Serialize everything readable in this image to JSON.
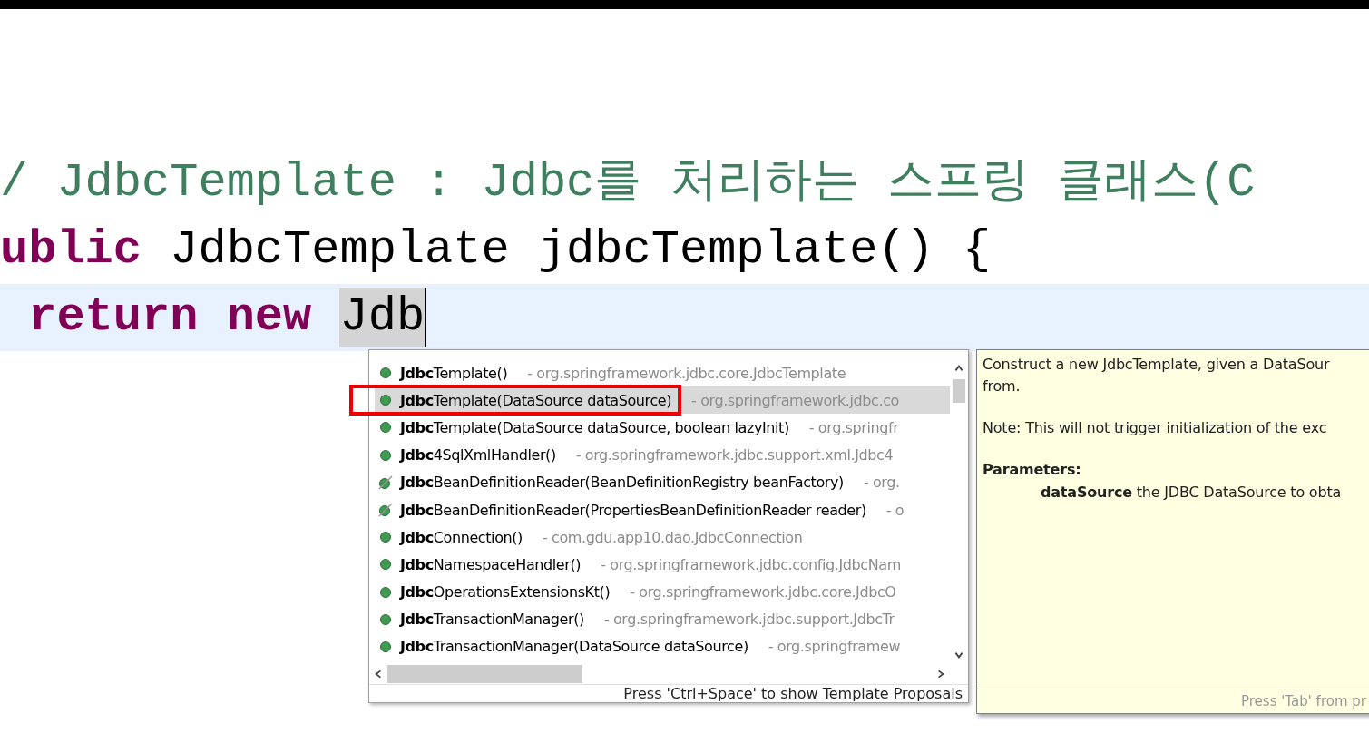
{
  "editor": {
    "lines": [
      {
        "current": false,
        "tokens": [
          {
            "kind": "comment",
            "text": "/ JdbcTemplate : Jdbc를 처리하는 스프링 클래스(C"
          }
        ]
      },
      {
        "current": false,
        "tokens": [
          {
            "kind": "keyword",
            "text": "ublic"
          },
          {
            "kind": "plain",
            "text": " JdbcTemplate jdbcTemplate() {"
          }
        ]
      },
      {
        "current": true,
        "tokens": [
          {
            "kind": "keyword",
            "text": " return new "
          },
          {
            "kind": "typed",
            "text": "Jdb"
          }
        ]
      }
    ]
  },
  "proposals": {
    "rows": [
      {
        "name": "**Jdbc**Template()",
        "qualifier": "- org.springframework.jdbc.core.JdbcTemplate",
        "kind": "method",
        "selected": false,
        "boxed": false
      },
      {
        "name": "**Jdbc**Template(DataSource dataSource)",
        "qualifier": "- org.springframework.jdbc.co",
        "kind": "method",
        "selected": true,
        "boxed": true
      },
      {
        "name": "**Jdbc**Template(DataSource dataSource, boolean lazyInit)",
        "qualifier": "- org.springfr",
        "kind": "method",
        "selected": false,
        "boxed": false
      },
      {
        "name": "**Jdbc**4SqlXmlHandler()",
        "qualifier": "- org.springframework.jdbc.support.xml.Jdbc4",
        "kind": "method",
        "selected": false,
        "boxed": false
      },
      {
        "name": "**Jdbc**BeanDefinitionReader(BeanDefinitionRegistry beanFactory)",
        "qualifier": "- org.",
        "kind": "deprecated",
        "selected": false,
        "boxed": false
      },
      {
        "name": "**Jdbc**BeanDefinitionReader(PropertiesBeanDefinitionReader reader)",
        "qualifier": "- o",
        "kind": "deprecated",
        "selected": false,
        "boxed": false
      },
      {
        "name": "**Jdbc**Connection()",
        "qualifier": "- com.gdu.app10.dao.JdbcConnection",
        "kind": "method",
        "selected": false,
        "boxed": false
      },
      {
        "name": "**Jdbc**NamespaceHandler()",
        "qualifier": "- org.springframework.jdbc.config.JdbcNam",
        "kind": "method",
        "selected": false,
        "boxed": false
      },
      {
        "name": "**Jdbc**OperationsExtensionsKt()",
        "qualifier": "- org.springframework.jdbc.core.JdbcO",
        "kind": "method",
        "selected": false,
        "boxed": false
      },
      {
        "name": "**Jdbc**TransactionManager()",
        "qualifier": "- org.springframework.jdbc.support.JdbcTr",
        "kind": "method",
        "selected": false,
        "boxed": false
      },
      {
        "name": "**Jdbc**TransactionManager(DataSource dataSource)",
        "qualifier": "- org.springframew",
        "kind": "method",
        "selected": false,
        "boxed": false
      }
    ],
    "footer": "Press 'Ctrl+Space' to show Template Proposals"
  },
  "doc": {
    "paragraphs": [
      "Construct a new JdbcTemplate, given a DataSour",
      "from.",
      "Note: This will not trigger initialization of the exc"
    ],
    "params_heading": "Parameters:",
    "param_name": "dataSource",
    "param_text": "the JDBC DataSource to obta",
    "footer": "Press 'Tab' from pr"
  }
}
